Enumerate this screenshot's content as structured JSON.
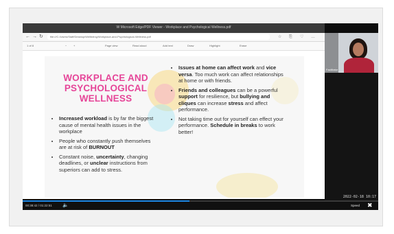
{
  "browser": {
    "window_title": "W Microsoft Edge/PDF Viewer - Workplace and Psychological Wellness.pdf",
    "url": "file:///C:/Users/Staff/Desktop/Wellbeing/Workplace-and-Psychological-Wellness.pdf",
    "nav_back": "←",
    "nav_forward": "→",
    "nav_reload": "↻",
    "tools": [
      "☆",
      "⎘",
      "♡",
      "…"
    ]
  },
  "pdf_toolbar": {
    "page_info": "1 of 8",
    "zoom_minus": "−",
    "zoom_plus": "+",
    "items": [
      "Page view",
      "Read aloud",
      "Add text",
      "Draw",
      "Highlight",
      "Erase"
    ]
  },
  "slide": {
    "title": "WORKPLACE AND PSYCHOLOGICAL WELLNESS",
    "left_bullets": [
      {
        "bold": "Increased workload",
        "text": " is by far the biggest cause of mental health issues in the workplace"
      },
      {
        "pre": "People who constantly push themselves are at risk of ",
        "bold": "BURNOUT"
      },
      {
        "pre": "Constant noise, ",
        "bold": "uncertainty",
        "mid": ", changing deadlines, or ",
        "bold2": "unclear",
        "text": " instructions from superiors can add to stress."
      }
    ],
    "right_bullets": [
      {
        "bold": "Issues at home can affect work",
        "mid": " and ",
        "bold2": "vice versa",
        "text": ". Too much work can affect relationships at home or with friends."
      },
      {
        "bold": "Friends and colleagues",
        "mid": " can be a powerful ",
        "bold2": "support",
        "text": " for resilience, but ",
        "bold3": "bullying and cliques",
        "mid2": " can increase ",
        "bold4": "stress",
        "text2": " and affect performance."
      },
      {
        "pre": "Not taking time out for yourself can effect your performance. ",
        "bold": "Schedule in breaks",
        "text": " to work better!"
      }
    ]
  },
  "webcam": {
    "name": "Facilitator"
  },
  "timestamp": "2022-02-18 10:17",
  "player": {
    "time": "00:38:42 / 01:22:51",
    "progress": 0.47,
    "volume_icon": "🔈",
    "speed": "Speed",
    "fullscreen_icon": "✖"
  },
  "colors": {
    "title_pink": "#e64598",
    "progress_blue": "#1e88e5"
  }
}
